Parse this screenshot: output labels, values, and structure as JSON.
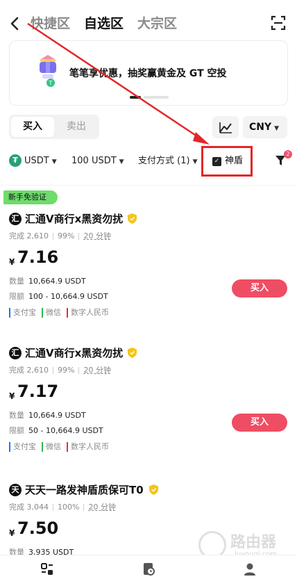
{
  "nav": {
    "back_icon": "chevron-left-icon",
    "tabs": [
      {
        "label": "快捷区",
        "active": false
      },
      {
        "label": "自选区",
        "active": true
      },
      {
        "label": "大宗区",
        "active": false
      }
    ],
    "scan_icon": "scan-icon"
  },
  "banner": {
    "text": "笔笔享优惠，抽奖赢黄金及 GT 空投",
    "page_indicator": {
      "current": 1,
      "total": 2
    }
  },
  "trade_side": {
    "buy_label": "买入",
    "sell_label": "卖出",
    "selected": "buy"
  },
  "currency": {
    "label": "CNY"
  },
  "filters": {
    "asset": "USDT",
    "amount": "100 USDT",
    "payment": "支付方式 (1)",
    "shield_label": "神盾",
    "shield_checked": true,
    "filter_badge": "2"
  },
  "new_user_tag": "新手免验证",
  "offers": [
    {
      "avatar": "汇",
      "merchant": "汇通V商行x黑资勿扰",
      "completed": "完成 2,610",
      "rate": "99%",
      "time": "20 分钟",
      "currency_symbol": "¥",
      "price": "7.16",
      "qty_label": "数量",
      "qty": "10,664.9 USDT",
      "limit_label": "限额",
      "limit": "100 - 10,664.9 USDT",
      "payments": [
        "支付宝",
        "微信",
        "数字人民币"
      ],
      "buy_label": "买入"
    },
    {
      "avatar": "汇",
      "merchant": "汇通V商行x黑资勿扰",
      "completed": "完成 2,610",
      "rate": "99%",
      "time": "20 分钟",
      "currency_symbol": "¥",
      "price": "7.17",
      "qty_label": "数量",
      "qty": "10,664.9 USDT",
      "limit_label": "限额",
      "limit": "50 - 10,664.9 USDT",
      "payments": [
        "支付宝",
        "微信",
        "数字人民币"
      ],
      "buy_label": "买入"
    },
    {
      "avatar": "天",
      "merchant": "天天一路发神盾质保可T0",
      "completed": "完成 3,044",
      "rate": "100%",
      "time": "20 分钟",
      "currency_symbol": "¥",
      "price": "7.50",
      "qty_label": "数量",
      "qty": "3,935 USDT"
    }
  ],
  "watermark": {
    "title": "路由器",
    "url": "luyouqi.com"
  },
  "colors": {
    "buy": "#ef4d63",
    "new_tag": "#6edc6b",
    "highlight": "#e3262a",
    "usdt": "#26a17b"
  }
}
